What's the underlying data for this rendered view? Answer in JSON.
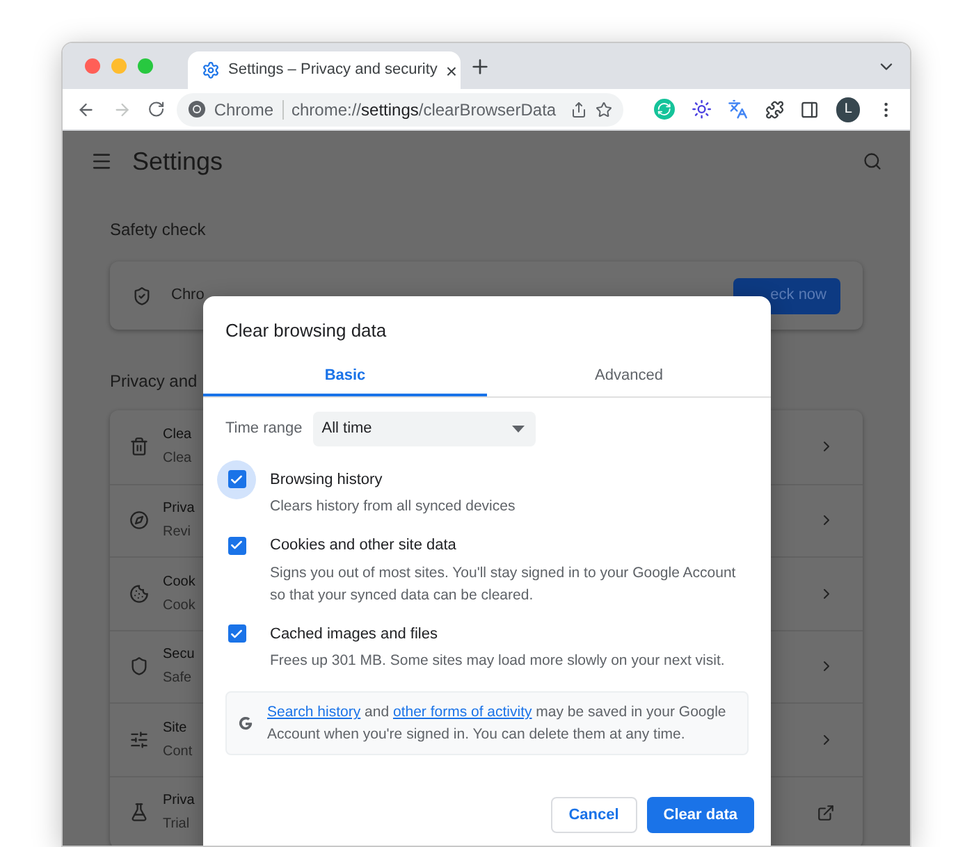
{
  "browser": {
    "tab_title": "Settings – Privacy and security",
    "close_tab": "×",
    "origin": "Chrome",
    "url": "chrome://**settings**/clearBrowserData",
    "profile_initial": "L",
    "forward_disabled": true
  },
  "settings": {
    "title": "Settings",
    "safety_check": {
      "heading": "Safety check",
      "text": "Chro",
      "button": "eck now"
    },
    "privacy": {
      "heading": "Privacy and",
      "rows": [
        {
          "kind": "submenu",
          "title": "Clea",
          "subtitle": "Clea"
        },
        {
          "kind": "submenu",
          "title": "Priva",
          "subtitle": "Revi"
        },
        {
          "kind": "submenu",
          "title": "Cook",
          "subtitle": "Cook"
        },
        {
          "kind": "submenu",
          "title": "Secu",
          "subtitle": "Safe"
        },
        {
          "kind": "submenu",
          "title": "Site",
          "subtitle": "Cont"
        },
        {
          "kind": "external",
          "title": "Priva",
          "subtitle": "Trial"
        }
      ]
    }
  },
  "dialog": {
    "title": "Clear browsing data",
    "tabs": [
      {
        "label": "Basic",
        "selected": true
      },
      {
        "label": "Advanced",
        "selected": false
      }
    ],
    "time_range": {
      "label": "Time range",
      "value": "All time"
    },
    "options": [
      {
        "title": "Browsing history",
        "description": "Clears history from all synced devices",
        "checked": true,
        "focused": true
      },
      {
        "title": "Cookies and other site data",
        "description": "Signs you out of most sites. You'll stay signed in to your Google Account so that your synced data can be cleared.",
        "checked": true,
        "focused": false
      },
      {
        "title": "Cached images and files",
        "description": "Frees up 301 MB. Some sites may load more slowly on your next visit.",
        "checked": true,
        "focused": false
      }
    ],
    "notice": [
      {
        "kind": "link",
        "text": "Search history"
      },
      {
        "kind": "text",
        "text": " and "
      },
      {
        "kind": "link",
        "text": "other forms of activity"
      },
      {
        "kind": "text",
        "text": " may be saved in your Google Account when you're signed in. You can delete them at any time."
      }
    ],
    "buttons": [
      {
        "kind": "secondary",
        "label": "Cancel"
      },
      {
        "kind": "primary",
        "label": "Clear data"
      }
    ]
  }
}
